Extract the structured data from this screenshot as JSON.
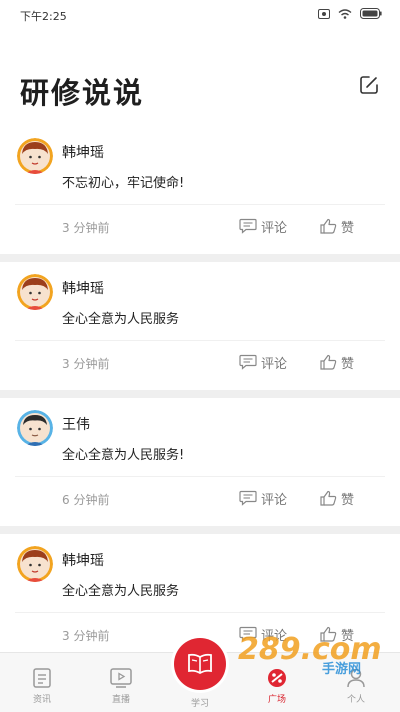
{
  "status_bar": {
    "time": "下午2:25"
  },
  "header": {
    "title": "研修说说"
  },
  "posts": [
    {
      "author": "韩坤瑶",
      "content": "不忘初心，牢记使命!",
      "time": "3 分钟前",
      "comment_label": "评论",
      "like_label": "赞",
      "avatar": "female-avatar"
    },
    {
      "author": "韩坤瑶",
      "content": "全心全意为人民服务",
      "time": "3 分钟前",
      "comment_label": "评论",
      "like_label": "赞",
      "avatar": "female-avatar"
    },
    {
      "author": "王伟",
      "content": "全心全意为人民服务!",
      "time": "6 分钟前",
      "comment_label": "评论",
      "like_label": "赞",
      "avatar": "male-avatar"
    },
    {
      "author": "韩坤瑶",
      "content": "全心全意为人民服务",
      "time": "3 分钟前",
      "comment_label": "评论",
      "like_label": "赞",
      "avatar": "female-avatar"
    }
  ],
  "nav": {
    "items": [
      {
        "label": "资讯",
        "icon": "news-icon"
      },
      {
        "label": "直播",
        "icon": "live-icon"
      },
      {
        "label": "学习",
        "icon": "book-icon"
      },
      {
        "label": "广场",
        "icon": "square-icon",
        "active": true
      },
      {
        "label": "个人",
        "icon": "person-icon"
      }
    ]
  },
  "watermark": {
    "text": "289.com",
    "subtext": "手游网"
  },
  "colors": {
    "accent": "#e02632",
    "avatar_ring": "#f2a420",
    "muted": "#9a9a9a",
    "separator": "#efefef"
  }
}
